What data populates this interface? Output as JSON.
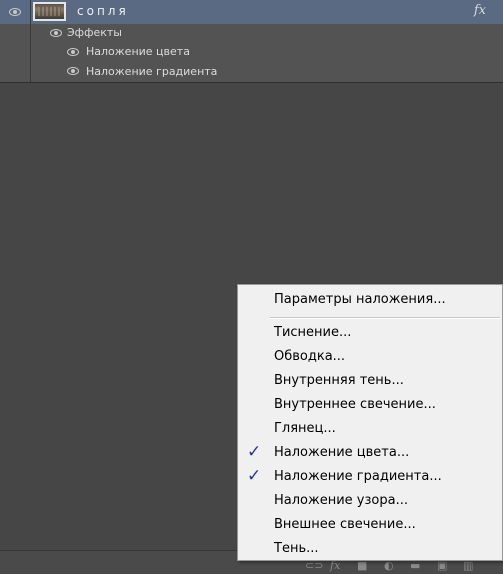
{
  "layer": {
    "name": "сопля",
    "fx_label": "fx",
    "effects_label": "Эффекты",
    "effects": [
      "Наложение цвета",
      "Наложение градиента"
    ]
  },
  "context_menu": {
    "items": [
      {
        "label": "Параметры наложения...",
        "checked": false
      },
      {
        "label": "Тиснение...",
        "checked": false
      },
      {
        "label": "Обводка...",
        "checked": false
      },
      {
        "label": "Внутренняя тень...",
        "checked": false
      },
      {
        "label": "Внутреннее свечение...",
        "checked": false
      },
      {
        "label": "Глянец...",
        "checked": false
      },
      {
        "label": "Наложение цвета...",
        "checked": true
      },
      {
        "label": "Наложение градиента...",
        "checked": true
      },
      {
        "label": "Наложение узора...",
        "checked": false
      },
      {
        "label": "Внешнее свечение...",
        "checked": false
      },
      {
        "label": "Тень...",
        "checked": false
      }
    ],
    "check_mark": "✓"
  },
  "colors": {
    "panel_bg": "#464646",
    "selected_layer": "#5a6a82",
    "menu_bg": "#f0f0f0",
    "check": "#1d3a9a"
  }
}
